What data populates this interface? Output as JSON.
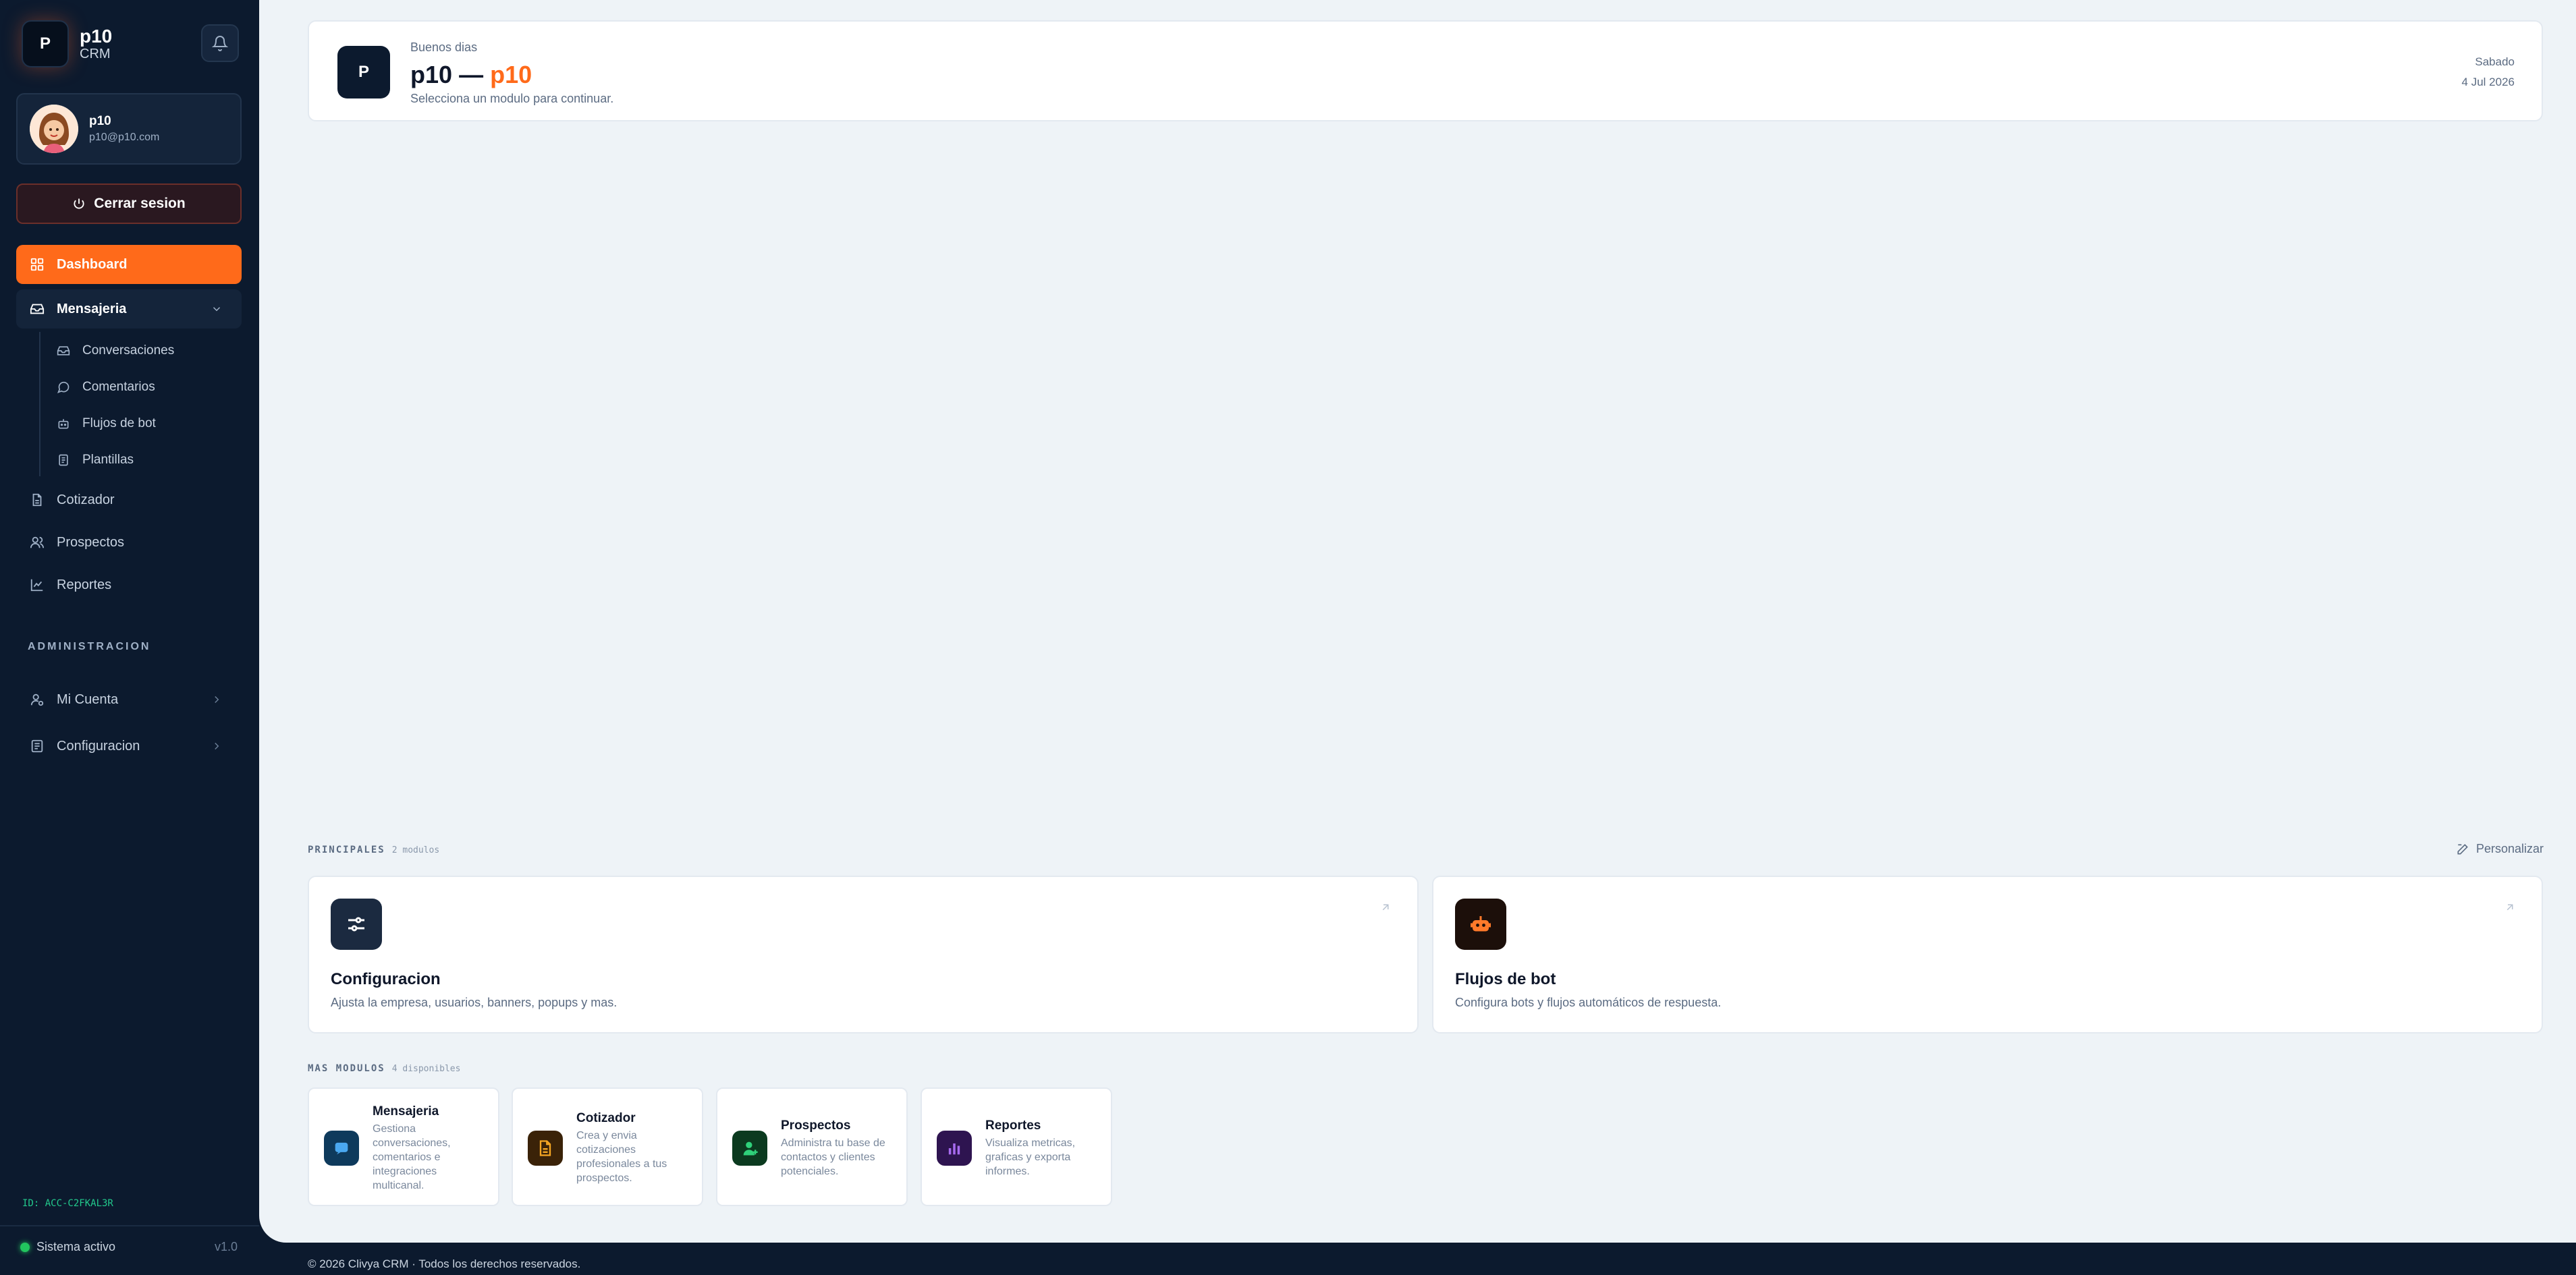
{
  "sidebar": {
    "brand_initial": "P",
    "brand_name": "p10",
    "brand_sub": "CRM",
    "user": {
      "name": "p10",
      "email": "p10@p10.com"
    },
    "logout_label": "Cerrar sesion",
    "nav": {
      "dashboard": "Dashboard",
      "mensajeria": "Mensajeria",
      "conversaciones": "Conversaciones",
      "comentarios": "Comentarios",
      "flujos": "Flujos de bot",
      "plantillas": "Plantillas",
      "cotizador": "Cotizador",
      "prospectos": "Prospectos",
      "reportes": "Reportes"
    },
    "admin_label": "ADMINISTRACION",
    "admin": {
      "mi_cuenta": "Mi Cuenta",
      "configuracion": "Configuracion"
    },
    "account_id": "ID: ACC-C2FKAL3R",
    "status": "Sistema activo",
    "version": "v1.0"
  },
  "hero": {
    "initial": "P",
    "greeting": "Buenos dias",
    "title_main": "p10",
    "title_sep": "—",
    "title_accent": "p10",
    "subtitle": "Selecciona un modulo para continuar.",
    "day": "Sabado",
    "date": "4 Jul 2026"
  },
  "principales": {
    "label": "PRINCIPALES",
    "count": "2 modulos",
    "personalize": "Personalizar",
    "cards": [
      {
        "title": "Configuracion",
        "desc": "Ajusta la empresa, usuarios, banners, popups y mas."
      },
      {
        "title": "Flujos de bot",
        "desc": "Configura bots y flujos automáticos de respuesta."
      }
    ]
  },
  "mas": {
    "label": "MAS MODULOS",
    "count": "4 disponibles",
    "cards": [
      {
        "title": "Mensajeria",
        "desc": "Gestiona conversaciones, comentarios e integraciones multicanal."
      },
      {
        "title": "Cotizador",
        "desc": "Crea y envia cotizaciones profesionales a tus prospectos."
      },
      {
        "title": "Prospectos",
        "desc": "Administra tu base de contactos y clientes potenciales."
      },
      {
        "title": "Reportes",
        "desc": "Visualiza metricas, graficas y exporta informes."
      }
    ]
  },
  "footer": "© 2026 Clivya CRM · Todos los derechos reservados.",
  "colors": {
    "accent": "#ff6a1a",
    "sidebar": "#0c1a2e",
    "background": "#eef3f7",
    "status": "#22c55e"
  }
}
